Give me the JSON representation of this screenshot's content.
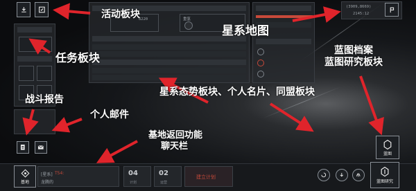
{
  "top_right": {
    "coords": "(3909,8669)",
    "time": "2145:12",
    "marker_icon": "flag-icon"
  },
  "overview": {
    "metric_value": "8220",
    "metric_label": "重氢"
  },
  "bottom_bar": {
    "base_label": "基地",
    "chat_channel": "[星系]",
    "chat_user": "T54:",
    "chat_message": "龙腾的",
    "counter1": "04",
    "counter1_label": "计划",
    "counter2": "02",
    "counter2_label": "运营",
    "build_plan": "建立计划",
    "blueprint_label": "蓝图",
    "blueprint_research_label": "蓝图研究"
  },
  "annotations": {
    "activity": "活动板块",
    "galaxy_map": "星系地图",
    "tasks": "任务板块",
    "blueprint_archive": "蓝图档案",
    "blueprint_research": "蓝图研究板块",
    "battle_report": "战斗报告",
    "personal_mail": "个人邮件",
    "galaxy_panels": "星系态势板块、个人名片、同盟板块",
    "base_return": "基地返回功能",
    "chat_bar": "聊天栏"
  },
  "colors": {
    "annotation_text": "#ffffff",
    "arrow": "#e0242b",
    "accent_red": "#c84a3a"
  }
}
